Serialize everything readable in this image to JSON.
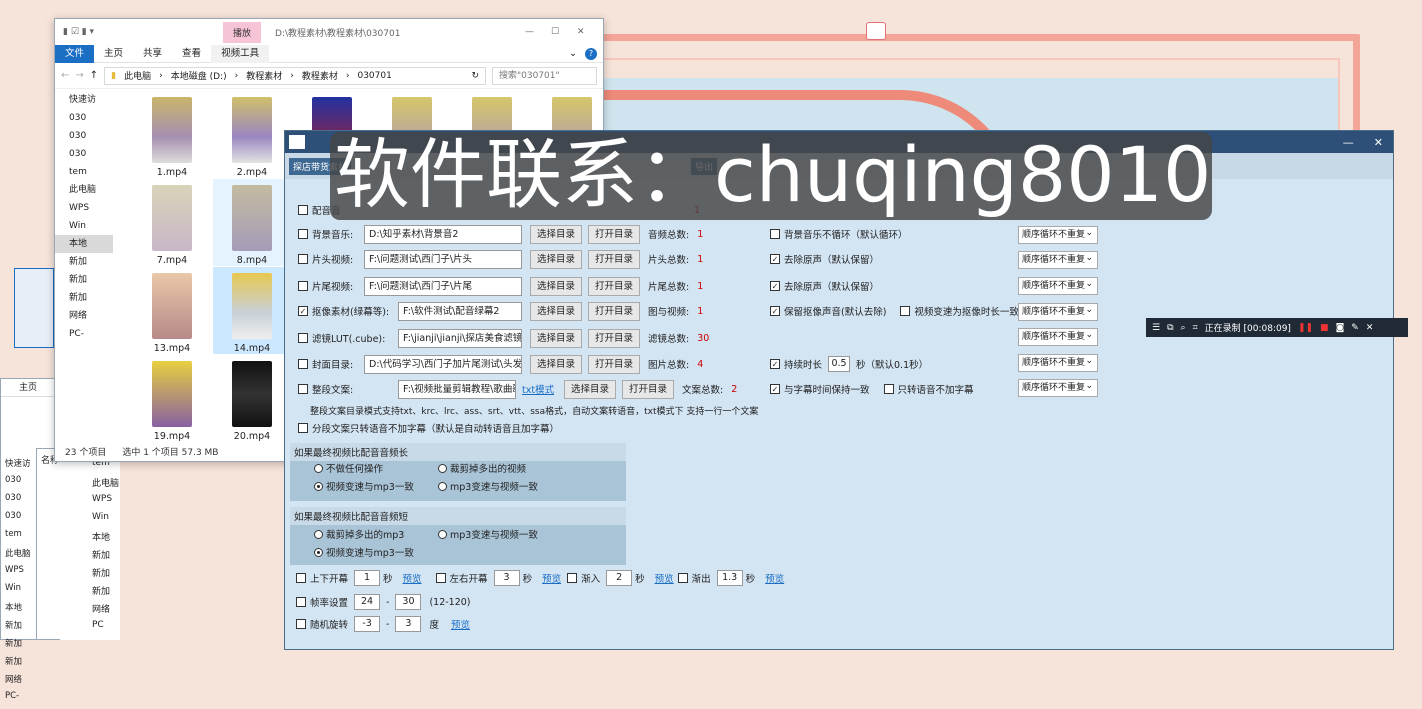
{
  "explorer": {
    "window_tab_active": "播放",
    "path_title": "D:\\教程素材\\教程素材\\030701",
    "ribbon_tabs": [
      "文件",
      "主页",
      "共享",
      "查看",
      "视频工具"
    ],
    "breadcrumb": [
      "此电脑",
      "本地磁盘 (D:)",
      "教程素材",
      "教程素材",
      "030701"
    ],
    "search_placeholder": "搜索\"030701\"",
    "nav_items": [
      "快速访",
      "030",
      "030",
      "030",
      "tem",
      "此电脑",
      "WPS",
      "Win",
      "本地",
      "新加",
      "新加",
      "新加",
      "网络",
      "PC-"
    ],
    "files": [
      "1.mp4",
      "2.mp4",
      "7.mp4",
      "8.mp4",
      "13.mp4",
      "14.mp4",
      "19.mp4",
      "20.mp4"
    ],
    "status_count": "23 个项目",
    "status_selected": "选中 1 个项目  57.3 MB"
  },
  "back_explorer": {
    "ribbon_home": "主页",
    "nav": [
      "快速访",
      "030",
      "030",
      "030",
      "tem",
      "此电脑",
      "WPS",
      "Win",
      "本地",
      "新加",
      "新加",
      "新加",
      "网络",
      "PC-"
    ],
    "col_name": "名称",
    "subitems": [
      "tem",
      "此电脑",
      "WPS",
      "Win",
      "本地",
      "新加",
      "新加",
      "新加",
      "网络",
      "PC"
    ]
  },
  "app": {
    "toolbar": [
      "探店带货素材",
      "导出"
    ],
    "rows": [
      {
        "label": "配音音",
        "value": "",
        "count_label": "",
        "count": "1"
      },
      {
        "label": "背景音乐:",
        "value": "D:\\知乎素材\\背景音2",
        "count_label": "音频总数:",
        "count": "1"
      },
      {
        "label": "片头视频:",
        "value": "F:\\问题测试\\西门子\\片头",
        "count_label": "片头总数:",
        "count": "1"
      },
      {
        "label": "片尾视频:",
        "value": "F:\\问题测试\\西门子\\片尾",
        "count_label": "片尾总数:",
        "count": "1"
      },
      {
        "label": "抠像素材(绿幕等):",
        "value": "F:\\软件测试\\配音绿幕2",
        "count_label": "图与视频:",
        "count": "1"
      },
      {
        "label": "滤镜LUT(.cube):",
        "value": "F:\\jianji\\jianji\\探店美食滤镜",
        "count_label": "滤镜总数:",
        "count": "30"
      },
      {
        "label": "封面目录:",
        "value": "D:\\代码学习\\西门子加片尾测试\\头发护",
        "count_label": "图片总数:",
        "count": "4"
      },
      {
        "label": "整段文案:",
        "value": "F:\\视频批量剪辑教程\\歌曲歌",
        "count_label": "文案总数:",
        "count": "2"
      }
    ],
    "btn_select": "选择目录",
    "btn_open": "打开目录",
    "txt_mode": "txt模式",
    "doc_help": "整段文案目录模式支持txt、krc、lrc、ass、srt、vtt、ssa格式，自动文案转语音，txt模式下 支持一行一个文案",
    "split_only": "分段文案只转语音不加字幕（默认是自动转语音且加字幕）",
    "right_opts": {
      "bgm_noloop": "背景音乐不循环（默认循环）",
      "remove_orig1": "去除原声（默认保留）",
      "remove_orig2": "去除原声（默认保留）",
      "keep_key_audio": "保留抠像声音(默认去除)",
      "key_speed": "视频变速为抠像时长一致",
      "duration_label": "持续时长",
      "duration_value": "0.5",
      "duration_unit": "秒（默认0.1秒）",
      "sub_sync": "与字幕时间保持一致",
      "voice_nosub": "只转语音不加字幕"
    },
    "order": "顺序循环不重复",
    "panel_long": {
      "title": "如果最终视频比配音音频长",
      "opts": [
        "不做任何操作",
        "裁剪掉多出的视频",
        "视频变速与mp3一致",
        "mp3变速与视频一致"
      ]
    },
    "panel_short": {
      "title": "如果最终视频比配音音频短",
      "opts": [
        "裁剪掉多出的mp3",
        "mp3变速与视频一致",
        "视频变速与mp3一致"
      ]
    },
    "effects": {
      "updown": "上下开幕",
      "updown_val": "1",
      "lr": "左右开幕",
      "lr_val": "3",
      "fadein": "渐入",
      "fadein_val": "2",
      "fadeout": "渐出",
      "fadeout_val": "1.3",
      "sec": "秒",
      "preview": "预览",
      "fps": "帧率设置",
      "fps_a": "24",
      "fps_b": "30",
      "fps_range": "(12-120)",
      "rot": "随机旋转",
      "rot_a": "-3",
      "rot_b": "3",
      "deg": "度"
    }
  },
  "watermark": "软件联系：chuqing8010",
  "recorder": {
    "status": "正在录制 [00:08:09]"
  }
}
